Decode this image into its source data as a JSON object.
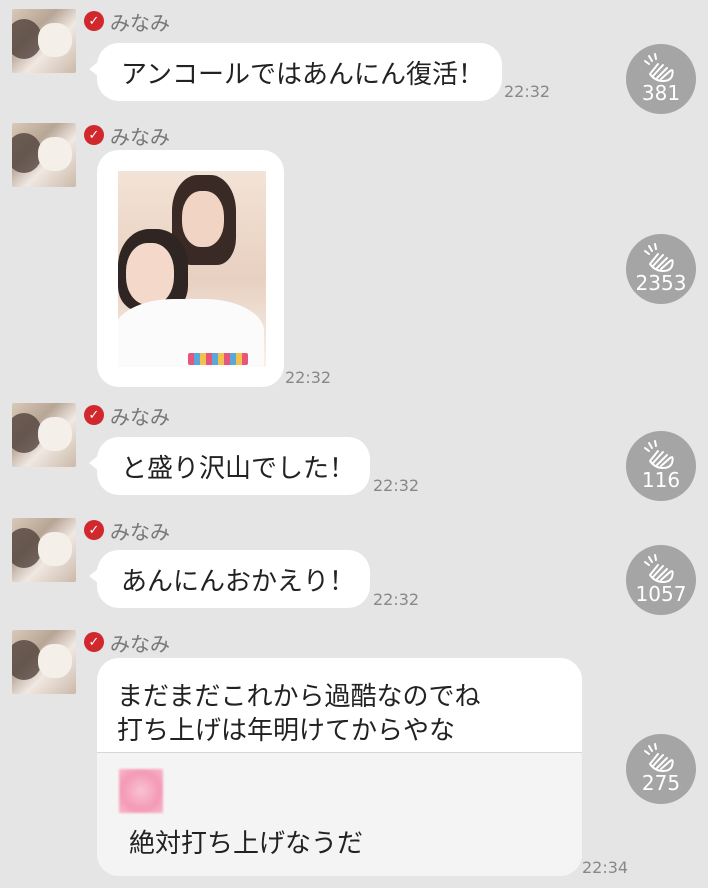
{
  "sender": {
    "name": "みなみ"
  },
  "messages": [
    {
      "text": "アンコールではあんにん復活！",
      "time": "22:32",
      "claps": "381"
    },
    {
      "type": "photo",
      "time": "22:32",
      "claps": "2353"
    },
    {
      "text": "と盛り沢山でした！",
      "time": "22:32",
      "claps": "116"
    },
    {
      "text": "あんにんおかえり！",
      "time": "22:32",
      "claps": "1057"
    },
    {
      "lines": [
        "まだまだこれから過酷なのでね",
        "打ち上げは年明けてからやな"
      ],
      "quote": "絶対打ち上げなうだ",
      "time": "22:34",
      "claps": "275"
    }
  ],
  "icons": {
    "badge": "check-badge-icon",
    "clap": "clap-hands-icon"
  },
  "colors": {
    "background": "#e5e5e5",
    "bubble": "#ffffff",
    "badge": "#d0282c",
    "clap_circle": "#a5a5a5"
  }
}
